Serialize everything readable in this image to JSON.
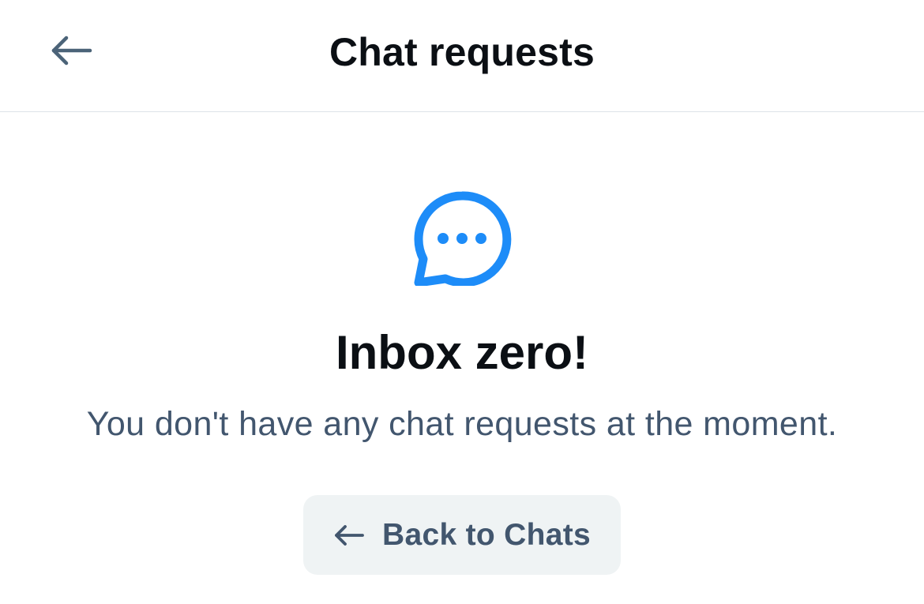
{
  "header": {
    "title": "Chat requests",
    "back_icon": "arrow-left-icon"
  },
  "empty_state": {
    "icon": "chat-bubble-ellipsis-icon",
    "heading": "Inbox zero!",
    "message": "You don't have any chat requests at the moment.",
    "button_label": "Back to Chats",
    "button_icon": "arrow-left-icon"
  },
  "colors": {
    "accent": "#1d8cf8",
    "title_text": "#0b0f14",
    "secondary_text": "#42566e",
    "button_bg": "#eff3f4",
    "divider": "#dde3e8"
  }
}
